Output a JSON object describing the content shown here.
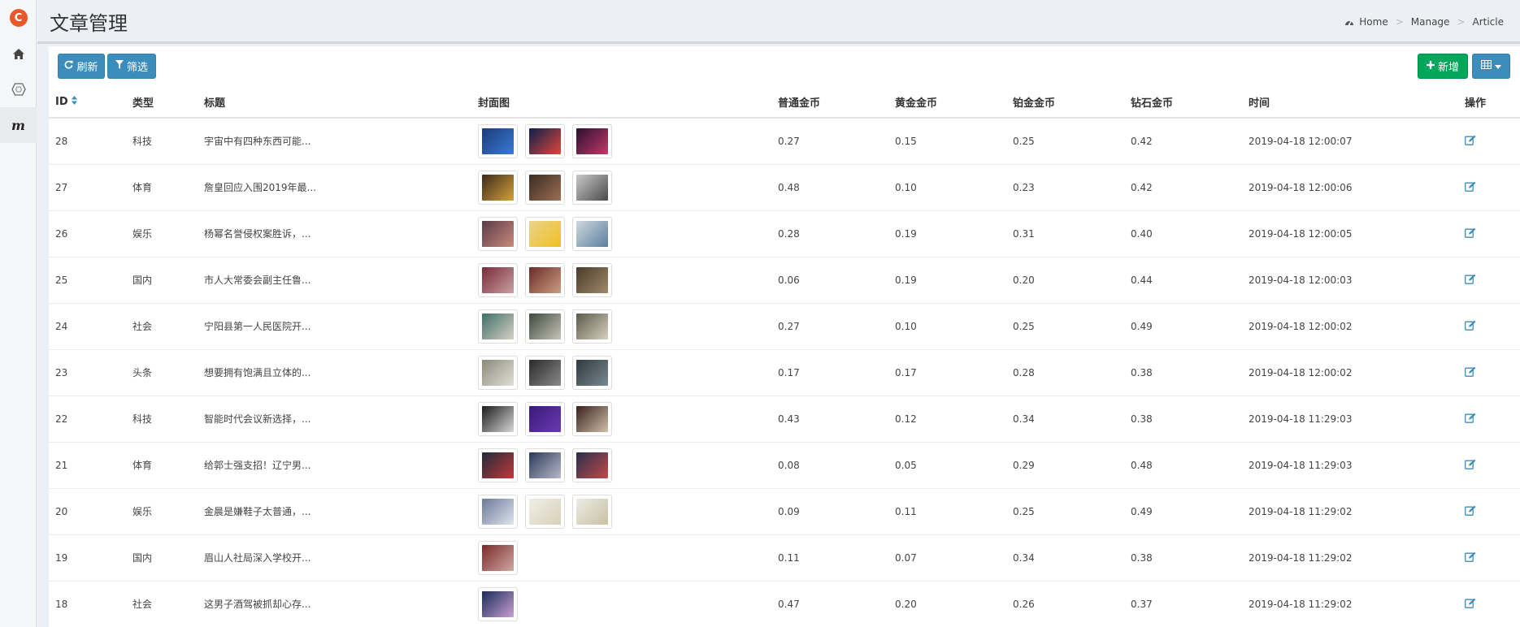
{
  "header": {
    "title": "文章管理"
  },
  "breadcrumb": [
    {
      "label": "Home"
    },
    {
      "label": "Manage"
    },
    {
      "label": "Article"
    }
  ],
  "sidebar": {
    "logo_text": "C",
    "items": [
      {
        "icon": "home-icon"
      },
      {
        "icon": "hexagon-icon"
      },
      {
        "icon": "m-logo-icon",
        "glyph": "m"
      }
    ]
  },
  "toolbar": {
    "refresh_label": "刷新",
    "filter_label": "筛选",
    "add_label": "新增"
  },
  "table": {
    "columns": [
      "ID",
      "类型",
      "标题",
      "封面图",
      "普通金币",
      "黄金金币",
      "铂金金币",
      "钻石金币",
      "时间",
      "操作"
    ],
    "rows": [
      {
        "id": "28",
        "type": "科技",
        "title": "宇宙中有四种东西可能...",
        "covers": [
          [
            "#1b3b78",
            "#3a7bd5"
          ],
          [
            "#0d1f4d",
            "#e0463a"
          ],
          [
            "#2a0f2f",
            "#c23a6b"
          ]
        ],
        "c1": "0.27",
        "c2": "0.15",
        "c3": "0.25",
        "c4": "0.42",
        "time": "2019-04-18 12:00:07"
      },
      {
        "id": "27",
        "type": "体育",
        "title": "詹皇回应入围2019年最...",
        "covers": [
          [
            "#3a2a1c",
            "#d4a23a"
          ],
          [
            "#3b2b24",
            "#9c6f55"
          ],
          [
            "#c9c9c9",
            "#4a4a4a"
          ]
        ],
        "c1": "0.48",
        "c2": "0.10",
        "c3": "0.23",
        "c4": "0.42",
        "time": "2019-04-18 12:00:06"
      },
      {
        "id": "26",
        "type": "娱乐",
        "title": "杨幂名誉侵权案胜诉，...",
        "covers": [
          [
            "#5a3b4b",
            "#c98a7a"
          ],
          [
            "#e8d48a",
            "#f0c020"
          ],
          [
            "#cfd8dc",
            "#5b7fa0"
          ]
        ],
        "c1": "0.28",
        "c2": "0.19",
        "c3": "0.31",
        "c4": "0.40",
        "time": "2019-04-18 12:00:05"
      },
      {
        "id": "25",
        "type": "国内",
        "title": "市人大常委会副主任鲁...",
        "covers": [
          [
            "#7a2a3a",
            "#c9a0a0"
          ],
          [
            "#6a2a2a",
            "#caa080"
          ],
          [
            "#4a3a2a",
            "#a08a6a"
          ]
        ],
        "c1": "0.06",
        "c2": "0.19",
        "c3": "0.20",
        "c4": "0.44",
        "time": "2019-04-18 12:00:03"
      },
      {
        "id": "24",
        "type": "社会",
        "title": "宁阳县第一人民医院开...",
        "covers": [
          [
            "#3f6f6a",
            "#d6d0c4"
          ],
          [
            "#3d4a3d",
            "#c8c4b8"
          ],
          [
            "#5a5a4a",
            "#d8d0c0"
          ]
        ],
        "c1": "0.27",
        "c2": "0.10",
        "c3": "0.25",
        "c4": "0.49",
        "time": "2019-04-18 12:00:02"
      },
      {
        "id": "23",
        "type": "头条",
        "title": "想要拥有饱满且立体的...",
        "covers": [
          [
            "#8a8a7a",
            "#e0e0d8"
          ],
          [
            "#2a2a2a",
            "#8a8a8a"
          ],
          [
            "#2f3a40",
            "#7a8a90"
          ]
        ],
        "c1": "0.17",
        "c2": "0.17",
        "c3": "0.28",
        "c4": "0.38",
        "time": "2019-04-18 12:00:02"
      },
      {
        "id": "22",
        "type": "科技",
        "title": "智能时代会议新选择，...",
        "covers": [
          [
            "#1a1a1a",
            "#d8d8d8"
          ],
          [
            "#3a1a7a",
            "#6a3ab0"
          ],
          [
            "#3a1f1f",
            "#d0c0a8"
          ]
        ],
        "c1": "0.43",
        "c2": "0.12",
        "c3": "0.34",
        "c4": "0.38",
        "time": "2019-04-18 11:29:03"
      },
      {
        "id": "21",
        "type": "体育",
        "title": "给郭士强支招！辽宁男...",
        "covers": [
          [
            "#1f2a3a",
            "#c03a3a"
          ],
          [
            "#2a3a5a",
            "#b8b8c8"
          ],
          [
            "#2a2f4a",
            "#c04a4a"
          ]
        ],
        "c1": "0.08",
        "c2": "0.05",
        "c3": "0.29",
        "c4": "0.48",
        "time": "2019-04-18 11:29:03"
      },
      {
        "id": "20",
        "type": "娱乐",
        "title": "金晨是嫌鞋子太普通，...",
        "covers": [
          [
            "#6a7a9a",
            "#e0e4ec"
          ],
          [
            "#f0eee8",
            "#d8d0b8"
          ],
          [
            "#ecece6",
            "#c8c0a0"
          ]
        ],
        "c1": "0.09",
        "c2": "0.11",
        "c3": "0.25",
        "c4": "0.49",
        "time": "2019-04-18 11:29:02"
      },
      {
        "id": "19",
        "type": "国内",
        "title": "眉山人社局深入学校开...",
        "covers": [
          [
            "#7a2a2a",
            "#d0a8a0"
          ]
        ],
        "c1": "0.11",
        "c2": "0.07",
        "c3": "0.34",
        "c4": "0.38",
        "time": "2019-04-18 11:29:02"
      },
      {
        "id": "18",
        "type": "社会",
        "title": "这男子酒驾被抓却心存...",
        "covers": [
          [
            "#1a2a5a",
            "#c8a0d0"
          ]
        ],
        "c1": "0.47",
        "c2": "0.20",
        "c3": "0.26",
        "c4": "0.37",
        "time": "2019-04-18 11:29:02"
      }
    ]
  },
  "colors": {
    "primary": "#3c8dbc",
    "success": "#00a65a",
    "logo": "#e8582b"
  }
}
